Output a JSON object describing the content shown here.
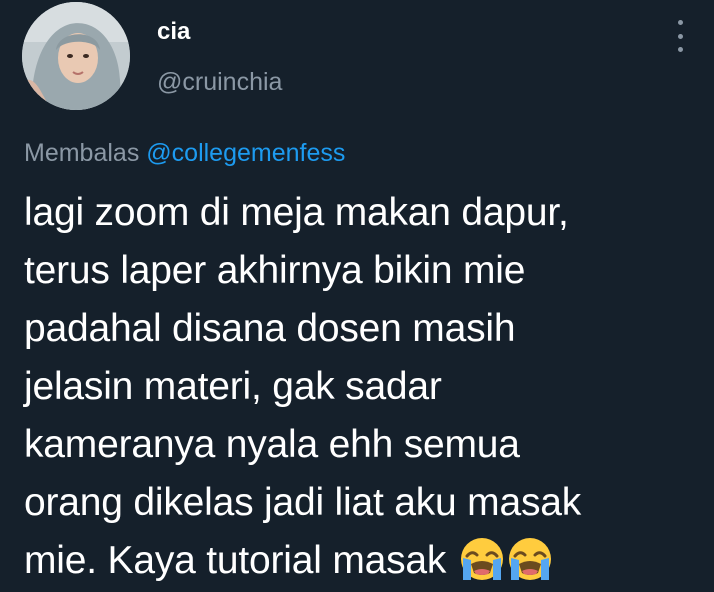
{
  "user": {
    "display_name": "cia",
    "handle": "@cruinchia",
    "avatar_icon": "profile-photo"
  },
  "reply": {
    "prefix": "Membalas",
    "mention": "@collegemenfess"
  },
  "tweet": {
    "lines": [
      "lagi zoom di meja makan dapur,",
      "terus laper akhirnya bikin mie",
      "padahal disana dosen masih",
      "jelasin materi, gak sadar",
      "kameranya nyala ehh semua",
      "orang dikelas jadi liat aku masak",
      "mie. Kaya tutorial masak"
    ],
    "emojis": [
      "loudly-crying-face-icon",
      "loudly-crying-face-icon"
    ]
  },
  "menu": {
    "icon": "more-options-icon"
  },
  "colors": {
    "background": "#15202b",
    "text": "#ffffff",
    "secondary": "#8b98a5",
    "accent": "#1d9bf0"
  }
}
